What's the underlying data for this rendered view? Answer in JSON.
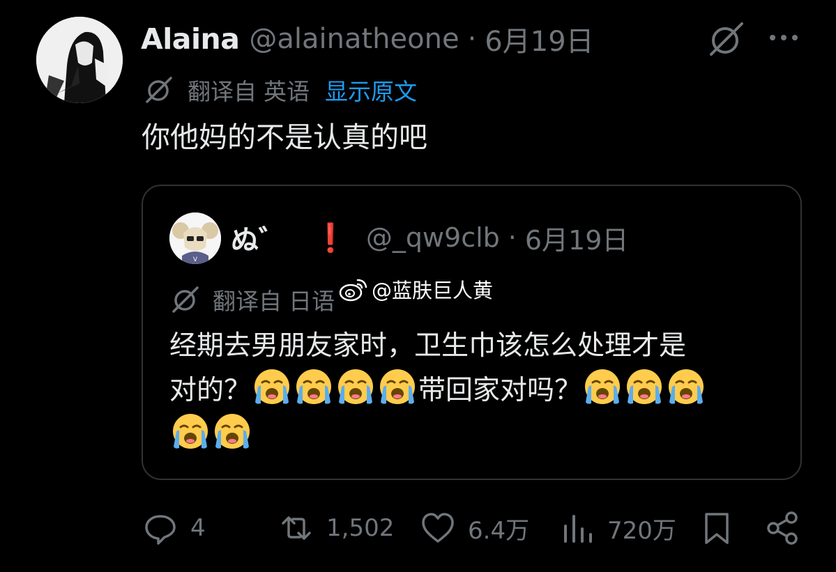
{
  "tweet": {
    "author": {
      "display_name": "Alaina",
      "handle": "@alainatheone",
      "separator": "·",
      "date": "6月19日"
    },
    "translation": {
      "prefix": "翻译自",
      "language": "英语",
      "show_original": "显示原文"
    },
    "text": "你他妈的不是认真的吧"
  },
  "quote": {
    "author": {
      "display_name": "ぬ゛",
      "badge": "❗",
      "handle": "@_qw9clb",
      "separator": "·",
      "date": "6月19日"
    },
    "translation": {
      "prefix": "翻译自",
      "language": "日语"
    },
    "text_line1": "经期去男朋友家时，卫生巾该怎么处理才是",
    "text_line2_a": "对的？",
    "text_line2_b": "带回家对吗？",
    "emoji_name": "loudly-crying-face"
  },
  "watermark": {
    "text": "@蓝肤巨人黄"
  },
  "actions": {
    "replies": "4",
    "reposts": "1,502",
    "likes": "6.4万",
    "views": "720万"
  },
  "colors": {
    "background": "#000000",
    "text_primary": "#e7e9ea",
    "text_secondary": "#71767b",
    "link": "#1d9bf0",
    "border": "#2f3336",
    "alert": "#f4212e"
  }
}
